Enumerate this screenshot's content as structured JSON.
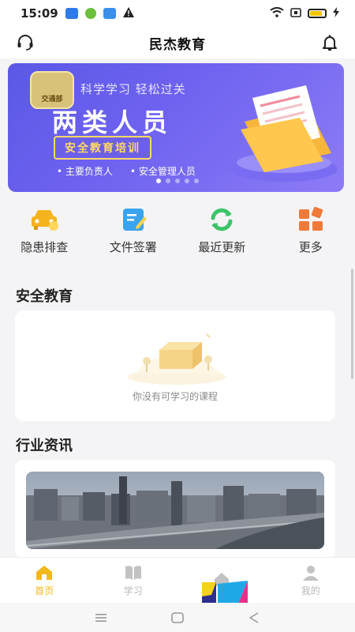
{
  "status_bar": {
    "time": "15:09"
  },
  "header": {
    "title": "民杰教育"
  },
  "banner": {
    "badge": "交通部",
    "tagline": "科学学习 轻松过关",
    "headline": "两类人员",
    "pill": "安全教育培训",
    "bullets": [
      "主要负责人",
      "安全管理人员"
    ],
    "page_count": 5,
    "active_page": 1
  },
  "quick_menu": [
    {
      "label": "隐患排查",
      "icon": "car-hazard-icon"
    },
    {
      "label": "文件签署",
      "icon": "document-sign-icon"
    },
    {
      "label": "最近更新",
      "icon": "refresh-icon"
    },
    {
      "label": "更多",
      "icon": "grid-more-icon"
    }
  ],
  "sections": {
    "safety_education": {
      "title": "安全教育",
      "empty_text": "你没有可学习的课程"
    },
    "industry_news": {
      "title": "行业资讯"
    }
  },
  "tabs": [
    {
      "label": "首页",
      "icon": "home-icon",
      "active": true
    },
    {
      "label": "学习",
      "icon": "book-icon",
      "active": false
    },
    {
      "label": "",
      "icon": "house-icon",
      "active": false
    },
    {
      "label": "我的",
      "icon": "user-icon",
      "active": false
    }
  ],
  "colors": {
    "accent": "#f3b81c",
    "banner_start": "#5b58e6",
    "banner_end": "#8d7cf6",
    "pill": "#ffd865"
  }
}
